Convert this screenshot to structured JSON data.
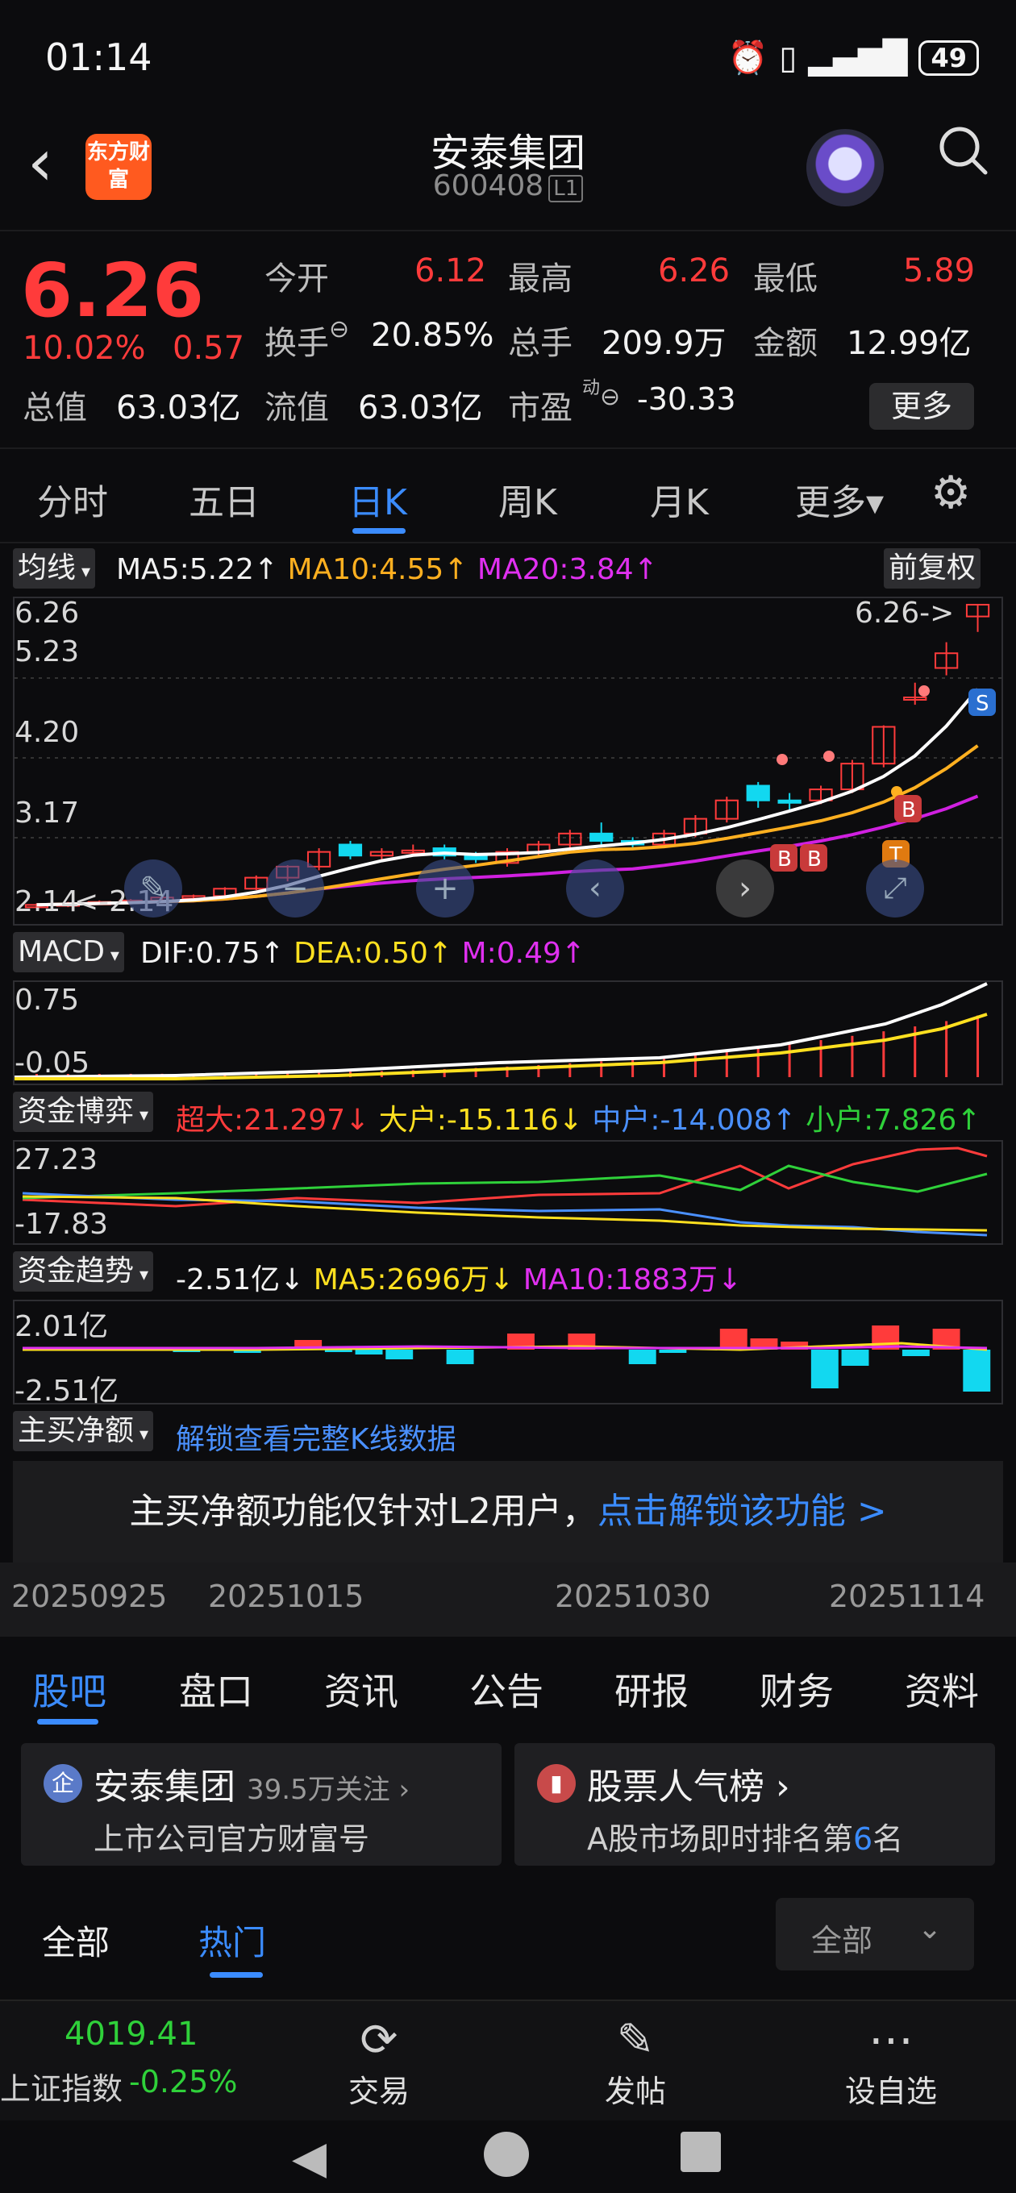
{
  "status_bar": {
    "time": "01:14",
    "battery": "49",
    "icons": [
      "alarm-icon",
      "vibrate-icon",
      "signal-icon",
      "battery-icon"
    ]
  },
  "header": {
    "title": "安泰集团",
    "code": "600408",
    "level": "L1",
    "logo_text": "东方财富"
  },
  "quote": {
    "price": "6.26",
    "change_pct": "10.02%",
    "change": "0.57",
    "open_label": "今开",
    "open": "6.12",
    "high_label": "最高",
    "high": "6.26",
    "low_label": "最低",
    "low": "5.89",
    "turnover_label": "换手",
    "turnover": "20.85%",
    "volume_label": "总手",
    "volume": "209.9万",
    "amount_label": "金额",
    "amount": "12.99亿",
    "mktcap_label": "总值",
    "mktcap": "63.03亿",
    "float_label": "流值",
    "float": "63.03亿",
    "pe_label": "市盈",
    "pe_sup": "动",
    "pe": "-30.33",
    "more_label": "更多"
  },
  "period_tabs": [
    "分时",
    "五日",
    "日K",
    "周K",
    "月K",
    "更多▾"
  ],
  "active_period": "日K",
  "kline": {
    "ma_label": "均线",
    "ma5": "MA5:5.22↑",
    "ma10": "MA10:4.55↑",
    "ma20": "MA20:3.84↑",
    "adjust": "前复权",
    "y_labels": [
      "6.26",
      "5.23",
      "4.20",
      "3.17",
      "2.14"
    ],
    "min_label": "<-2.14",
    "max_label": "6.26->",
    "colors": {
      "ma5": "#ffffff",
      "ma10": "#ffb020",
      "ma20": "#d020e0",
      "up": "#ff3b3b",
      "down": "#12d8f0"
    }
  },
  "macd": {
    "label": "MACD",
    "dif": "DIF:0.75↑",
    "dea": "DEA:0.50↑",
    "m": "M:0.49↑",
    "y_labels": [
      "0.75",
      "-0.05"
    ]
  },
  "fund_game": {
    "label": "资金博弈",
    "super": "超大:21.297↓",
    "big": "大户:-15.116↓",
    "mid": "中户:-14.008↑",
    "small": "小户:7.826↑",
    "y_labels": [
      "27.23",
      "-17.83"
    ]
  },
  "fund_trend": {
    "label": "资金趋势",
    "value": "-2.51亿↓",
    "ma5": "MA5:2696万↓",
    "ma10": "MA10:1883万↓",
    "y_labels": [
      "2.01亿",
      "-2.51亿"
    ]
  },
  "net_buy": {
    "label": "主买净额",
    "unlock_link": "解锁查看完整K线数据",
    "notice": "主买净额功能仅针对L2用户，",
    "notice_link": "点击解锁该功能 >"
  },
  "dates": [
    "20250925",
    "20251015",
    "20251030",
    "20251114"
  ],
  "bottom_tabs": [
    "股吧",
    "盘口",
    "资讯",
    "公告",
    "研报",
    "财务",
    "资料"
  ],
  "cards": [
    {
      "title": "安泰集团",
      "meta": "39.5万关注 ›",
      "sub": "上市公司官方财富号"
    },
    {
      "title": "股票人气榜 ›",
      "sub_pre": "A股市场即时排名第",
      "sub_num": "6",
      "sub_post": "名"
    }
  ],
  "feed_tabs": [
    "全部",
    "热门"
  ],
  "feed_filter": "全部",
  "index": {
    "value": "4019.41",
    "name": "上证指数",
    "change": "-0.25%"
  },
  "nav": [
    "交易",
    "发帖",
    "设自选"
  ]
}
